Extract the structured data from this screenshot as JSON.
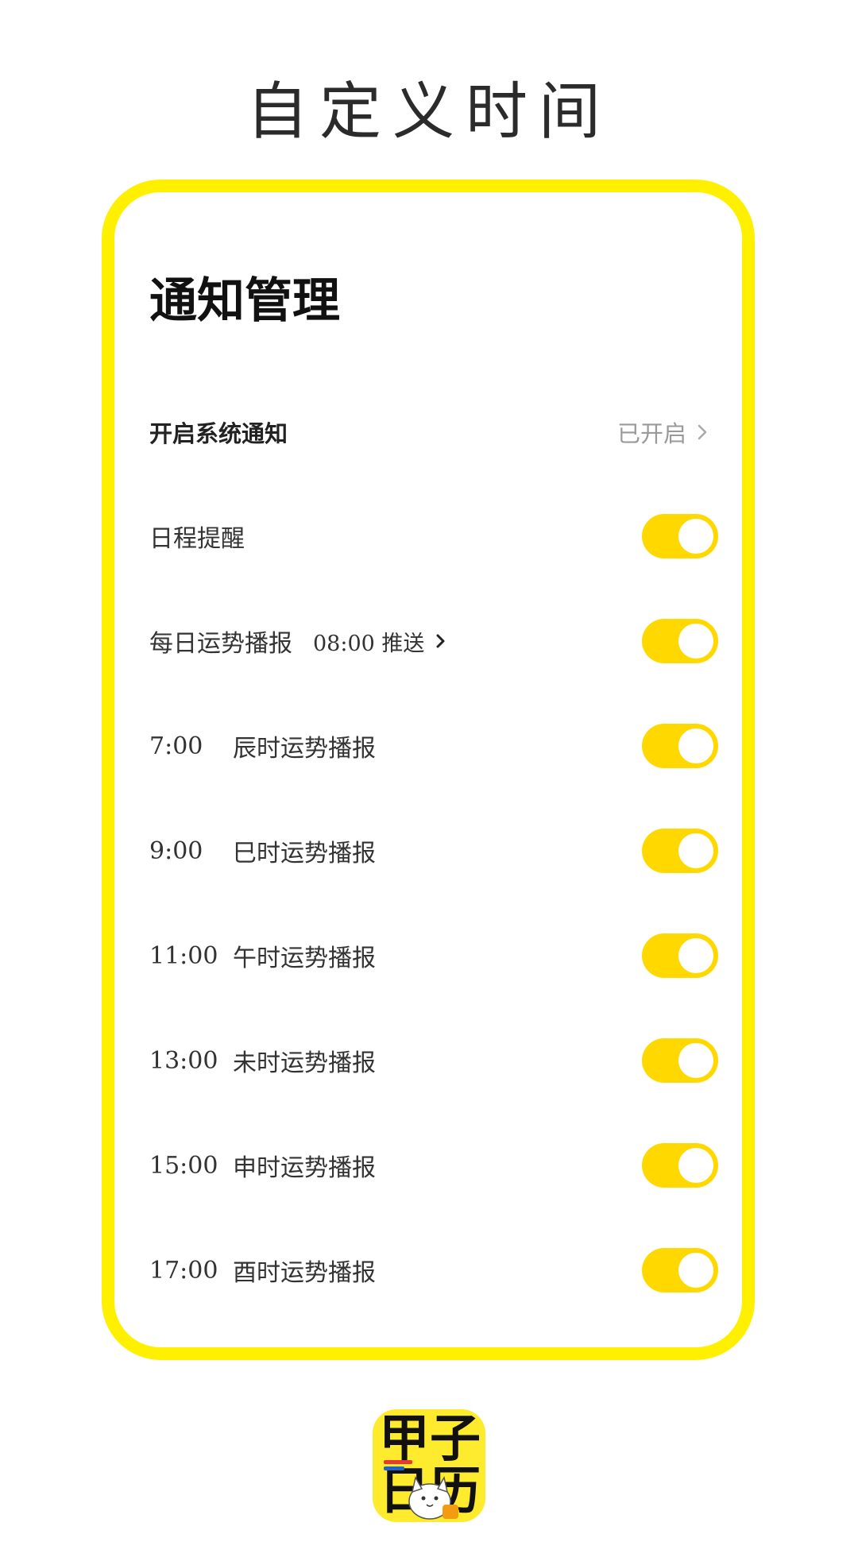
{
  "promo": {
    "title": "自定义时间"
  },
  "screen": {
    "title": "通知管理",
    "system_notification": {
      "label": "开启系统通知",
      "status": "已开启"
    },
    "schedule_reminder": {
      "label": "日程提醒",
      "on": true
    },
    "daily_fortune": {
      "label": "每日运势播报",
      "push_time": "08:00 推送",
      "on": true
    },
    "hour_items": [
      {
        "time": "7:00",
        "label": "辰时运势播报",
        "on": true
      },
      {
        "time": "9:00",
        "label": "巳时运势播报",
        "on": true
      },
      {
        "time": "11:00",
        "label": "午时运势播报",
        "on": true
      },
      {
        "time": "13:00",
        "label": "未时运势播报",
        "on": true
      },
      {
        "time": "15:00",
        "label": "申时运势播报",
        "on": true
      },
      {
        "time": "17:00",
        "label": "酉时运势播报",
        "on": true
      }
    ]
  },
  "app_logo": {
    "line1": "甲子",
    "line2": "日历"
  },
  "colors": {
    "accent": "#FFD800",
    "frame": "#FFF000",
    "status_gray": "#9a9a9a"
  },
  "icons": {
    "chevron_gray": "chevron-right-icon",
    "chevron_dark": "chevron-right-icon"
  }
}
